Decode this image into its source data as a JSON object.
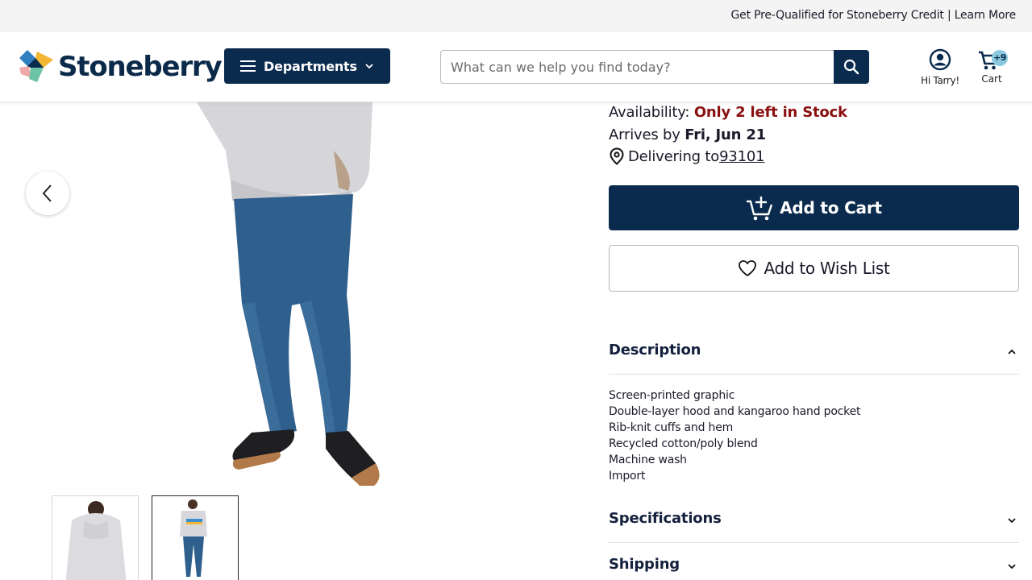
{
  "promo": {
    "text": "Get Pre-Qualified for Stoneberry Credit | Learn More"
  },
  "header": {
    "logo_text": "Stoneberry",
    "departments_label": "Departments",
    "search_placeholder": "What can we help you find today?",
    "account_label": "Hi Tarry!",
    "cart_label": "Cart",
    "cart_badge": "+9"
  },
  "product": {
    "availability_label": "Availability:",
    "availability_value": "Only 2 left in Stock",
    "arrives_label": "Arrives by",
    "arrives_value": "Fri, Jun 21",
    "delivering_label": "Delivering to",
    "zip": "93101",
    "add_to_cart_label": "Add to Cart",
    "wish_list_label": "Add to Wish List"
  },
  "sections": {
    "description_title": "Description",
    "description_items": [
      "Screen-printed graphic",
      "Double-layer hood and kangaroo hand pocket",
      "Rib-knit cuffs and hem",
      "Recycled cotton/poly blend",
      "Machine wash",
      "Import"
    ],
    "specifications_title": "Specifications",
    "shipping_title": "Shipping"
  },
  "colors": {
    "navy": "#0b2b4e",
    "stock_red": "#8b1010",
    "badge_blue": "#8ac9e0"
  }
}
